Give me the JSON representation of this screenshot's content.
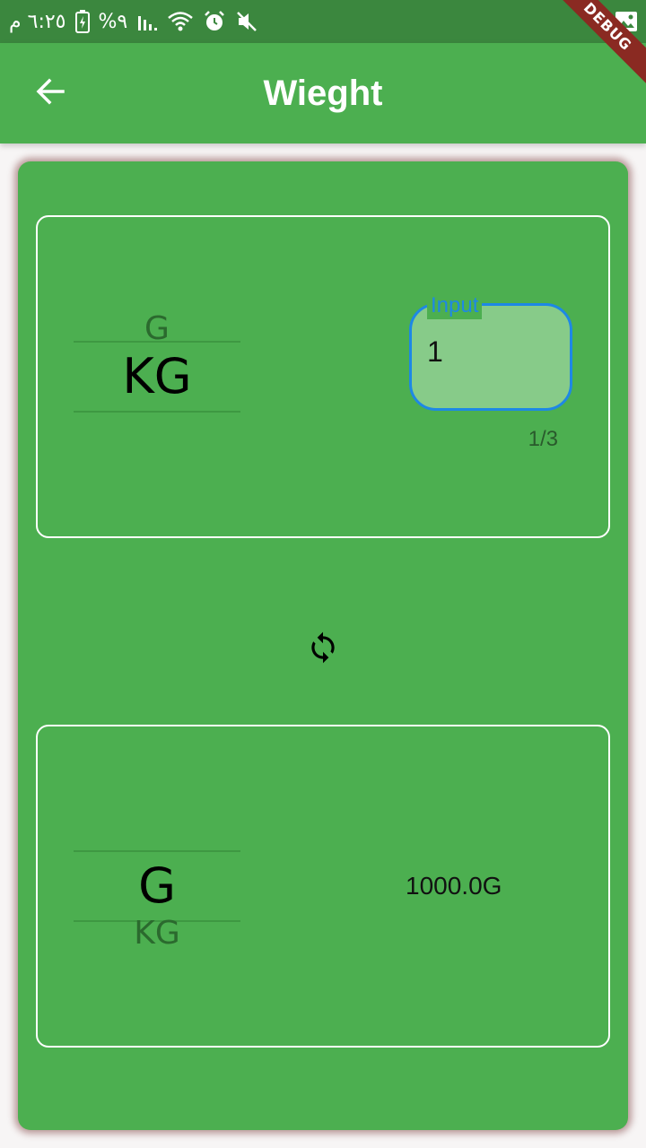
{
  "status_bar": {
    "time": "٦:٢٥ م",
    "battery_percent": "%٩",
    "icons": [
      "battery-charging-icon",
      "signal-icon",
      "wifi-icon",
      "alarm-icon",
      "mute-icon",
      "image-icon"
    ]
  },
  "debug_banner": "DEBUG",
  "app_bar": {
    "title": "Wieght",
    "back_icon": "arrow-back-icon"
  },
  "from_panel": {
    "picker_above": "G",
    "picker_selected": "KG",
    "input_label": "Input",
    "input_value": "1",
    "counter": "1/3"
  },
  "swap_icon": "refresh-icon",
  "to_panel": {
    "picker_selected": "G",
    "picker_below": "KG",
    "result": "1000.0G"
  },
  "colors": {
    "primary": "#4caf50",
    "status_bar": "#3b873e",
    "input_fill": "#87cb89",
    "input_accent": "#1e88e5",
    "debug": "#8a2a22"
  }
}
